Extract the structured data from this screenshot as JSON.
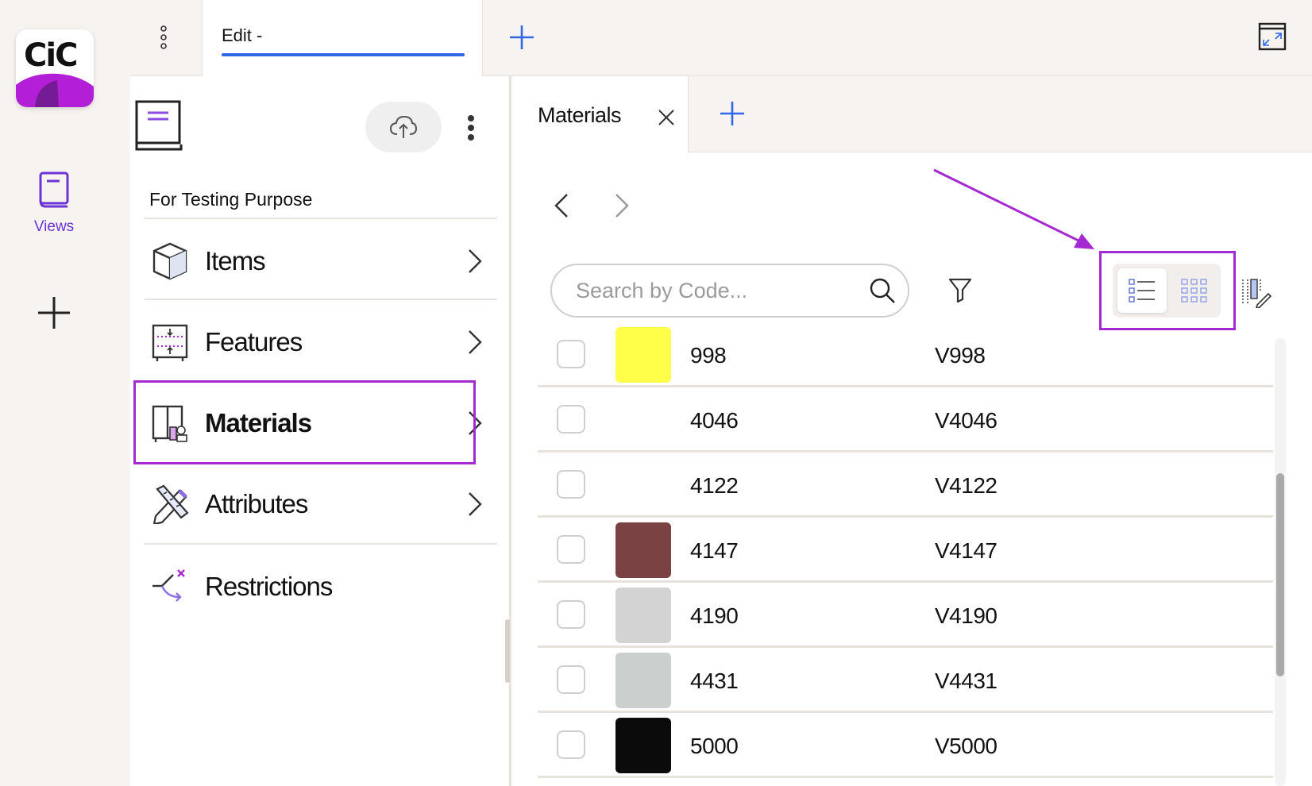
{
  "rail": {
    "logo_text": "CiC",
    "views_label": "Views"
  },
  "top_tabs": {
    "active_tab_label": "Edit -"
  },
  "panel": {
    "title": "For Testing Purpose",
    "items": [
      {
        "label": "Items",
        "icon": "cube-icon"
      },
      {
        "label": "Features",
        "icon": "features-icon"
      },
      {
        "label": "Materials",
        "icon": "materials-icon",
        "active": true
      },
      {
        "label": "Attributes",
        "icon": "pencil-ruler-icon"
      },
      {
        "label": "Restrictions",
        "icon": "restrictions-icon"
      }
    ]
  },
  "content": {
    "tab_label": "Materials",
    "search_placeholder": "Search by Code...",
    "rows": [
      {
        "code": "998",
        "vcode": "V998",
        "swatch": "#ffff4a"
      },
      {
        "code": "4046",
        "vcode": "V4046",
        "swatch": ""
      },
      {
        "code": "4122",
        "vcode": "V4122",
        "swatch": ""
      },
      {
        "code": "4147",
        "vcode": "V4147",
        "swatch": "#7a4242"
      },
      {
        "code": "4190",
        "vcode": "V4190",
        "swatch": "#d3d3d3"
      },
      {
        "code": "4431",
        "vcode": "V4431",
        "swatch": "#cbd0cf"
      },
      {
        "code": "5000",
        "vcode": "V5000",
        "swatch": "#0b0b0b"
      }
    ]
  },
  "colors": {
    "accent_blue": "#2f67e8",
    "highlight_purple": "#a529d1",
    "views_purple": "#6b34d6"
  }
}
